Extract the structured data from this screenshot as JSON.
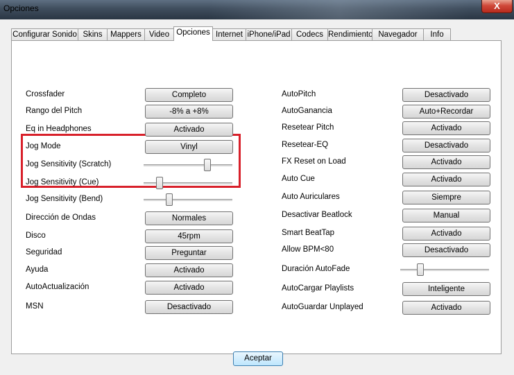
{
  "window": {
    "title": "Opciones",
    "close_label": "X"
  },
  "tabs": [
    "Configurar Sonido",
    "Skins",
    "Mappers",
    "Video",
    "Opciones",
    "Internet",
    "iPhone/iPad",
    "Codecs",
    "Rendimiento",
    "Navegador",
    "Info"
  ],
  "active_tab": "Opciones",
  "left_rows": [
    {
      "label": "Crossfader",
      "value": "Completo"
    },
    {
      "label": "Rango del Pitch",
      "value": "-8% a +8%"
    },
    {
      "label": "Eq in Headphones",
      "value": "Activado"
    },
    {
      "label": "Jog Mode",
      "value": "Vinyl"
    },
    {
      "label": "Jog Sensitivity (Scratch)",
      "slider_level": 0.74
    },
    {
      "label": "Jog Sensitivity (Cue)",
      "slider_level": 0.15
    },
    {
      "label": "Jog Sensitivity (Bend)",
      "slider_level": 0.27
    },
    {
      "label": "Dirección de Ondas",
      "value": "Normales"
    },
    {
      "label": "Disco",
      "value": "45rpm"
    },
    {
      "label": "Seguridad",
      "value": "Preguntar"
    },
    {
      "label": "Ayuda",
      "value": "Activado"
    },
    {
      "label": "AutoActualización",
      "value": "Activado"
    },
    {
      "label": "MSN",
      "value": "Desactivado"
    }
  ],
  "right_rows": [
    {
      "label": "AutoPitch",
      "value": "Desactivado"
    },
    {
      "label": "AutoGanancia",
      "value": "Auto+Recordar"
    },
    {
      "label": "Resetear Pitch",
      "value": "Activado"
    },
    {
      "label": "Resetear-EQ",
      "value": "Desactivado"
    },
    {
      "label": "FX Reset on Load",
      "value": "Activado"
    },
    {
      "label": "Auto Cue",
      "value": "Activado"
    },
    {
      "label": "Auto Auriculares",
      "value": "Siempre"
    },
    {
      "label": "Desactivar Beatlock",
      "value": "Manual"
    },
    {
      "label": "Smart BeatTap",
      "value": "Activado"
    },
    {
      "label": "Allow BPM<80",
      "value": "Desactivado"
    },
    {
      "label": "Duración AutoFade",
      "slider_level": 0.2
    },
    {
      "label": "AutoCargar Playlists",
      "value": "Inteligente"
    },
    {
      "label": "AutoGuardar Unplayed",
      "value": "Activado"
    }
  ],
  "accept_label": "Aceptar"
}
